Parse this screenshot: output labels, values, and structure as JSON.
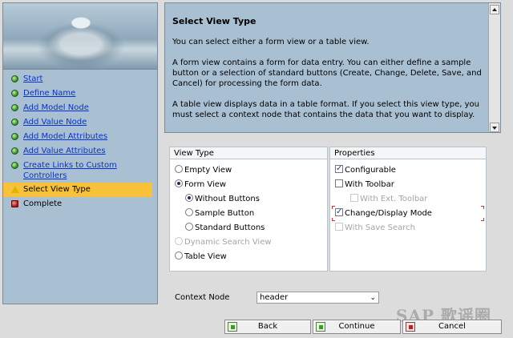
{
  "wizard_steps": [
    {
      "label": "Start",
      "status": "done"
    },
    {
      "label": "Define Name",
      "status": "done"
    },
    {
      "label": "Add Model Node",
      "status": "done"
    },
    {
      "label": "Add Value Node",
      "status": "done"
    },
    {
      "label": "Add Model Attributes",
      "status": "done"
    },
    {
      "label": "Add Value Attributes",
      "status": "done"
    },
    {
      "label": "Create Links to Custom Controllers",
      "status": "done"
    },
    {
      "label": "Select View Type",
      "status": "current"
    },
    {
      "label": "Complete",
      "status": "pending"
    }
  ],
  "description": {
    "title": "Select View Type",
    "paragraphs": [
      "You can select either a form view or a table view.",
      "A form view contains a form for data entry. You can either define a sample button or a selection of standard buttons (Create, Change, Delete, Save, and Cancel) for processing the form data.",
      "A table view displays data in a table format. If you select this view type, you must select a context node that contains the data that you want to display."
    ]
  },
  "view_type": {
    "title": "View Type",
    "options": {
      "empty": "Empty View",
      "form": "Form View",
      "without_buttons": "Without Buttons",
      "sample_button": "Sample Button",
      "standard_buttons": "Standard Buttons",
      "dynamic_search": "Dynamic Search View",
      "table": "Table View"
    },
    "selected": "Form View",
    "form_sub_selected": "Without Buttons"
  },
  "properties": {
    "title": "Properties",
    "configurable": "Configurable",
    "with_toolbar": "With Toolbar",
    "with_ext_toolbar": "With Ext. Toolbar",
    "change_display_mode": "Change/Display Mode",
    "with_save_search": "With Save Search"
  },
  "context_node": {
    "label": "Context Node",
    "value": "header"
  },
  "buttons": {
    "back": "Back",
    "continue": "Continue",
    "cancel": "Cancel"
  },
  "watermark": "SAP 歌谣圈",
  "colors": {
    "current_step": "#f7c23a",
    "link": "#0a32c8",
    "panel_bg": "#a8c0d2"
  }
}
